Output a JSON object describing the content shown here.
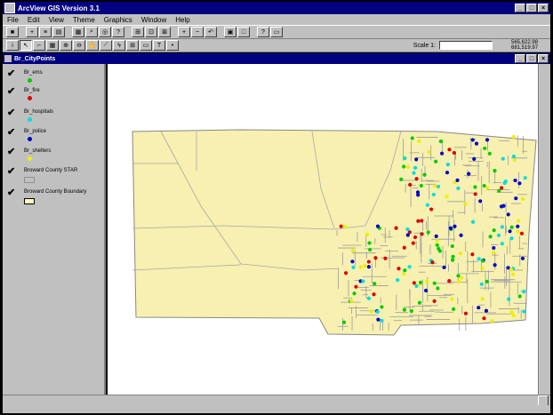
{
  "app": {
    "title": "ArcView GIS Version 3.1"
  },
  "menu": [
    {
      "label": "File"
    },
    {
      "label": "Edit"
    },
    {
      "label": "View"
    },
    {
      "label": "Theme"
    },
    {
      "label": "Graphics"
    },
    {
      "label": "Window"
    },
    {
      "label": "Help"
    }
  ],
  "toolbar": {
    "scale_label": "Scale 1:",
    "scale_value": "",
    "coord_x": "565,622.98",
    "coord_y": "681,519.97"
  },
  "view": {
    "title": "Br_CityPoints"
  },
  "themes": [
    {
      "name": "Br_ems",
      "symbol": "#00cc00",
      "type": "point"
    },
    {
      "name": "Br_fire",
      "symbol": "#dd0000",
      "type": "point"
    },
    {
      "name": "Br_hospitals",
      "symbol": "#00dddd",
      "type": "point"
    },
    {
      "name": "Br_police",
      "symbol": "#0000cc",
      "type": "point"
    },
    {
      "name": "Br_shelters",
      "symbol": "#eeee00",
      "type": "point"
    },
    {
      "name": "Broward County STAR",
      "symbol": "#c0c0c0",
      "type": "polygon"
    },
    {
      "name": "Broward County Boundary",
      "symbol": "#fffcc0",
      "type": "polygon"
    }
  ],
  "colors": {
    "county_fill": "#f7f0b0",
    "roads": "#9c9c9c",
    "titlebar": "#000080"
  }
}
